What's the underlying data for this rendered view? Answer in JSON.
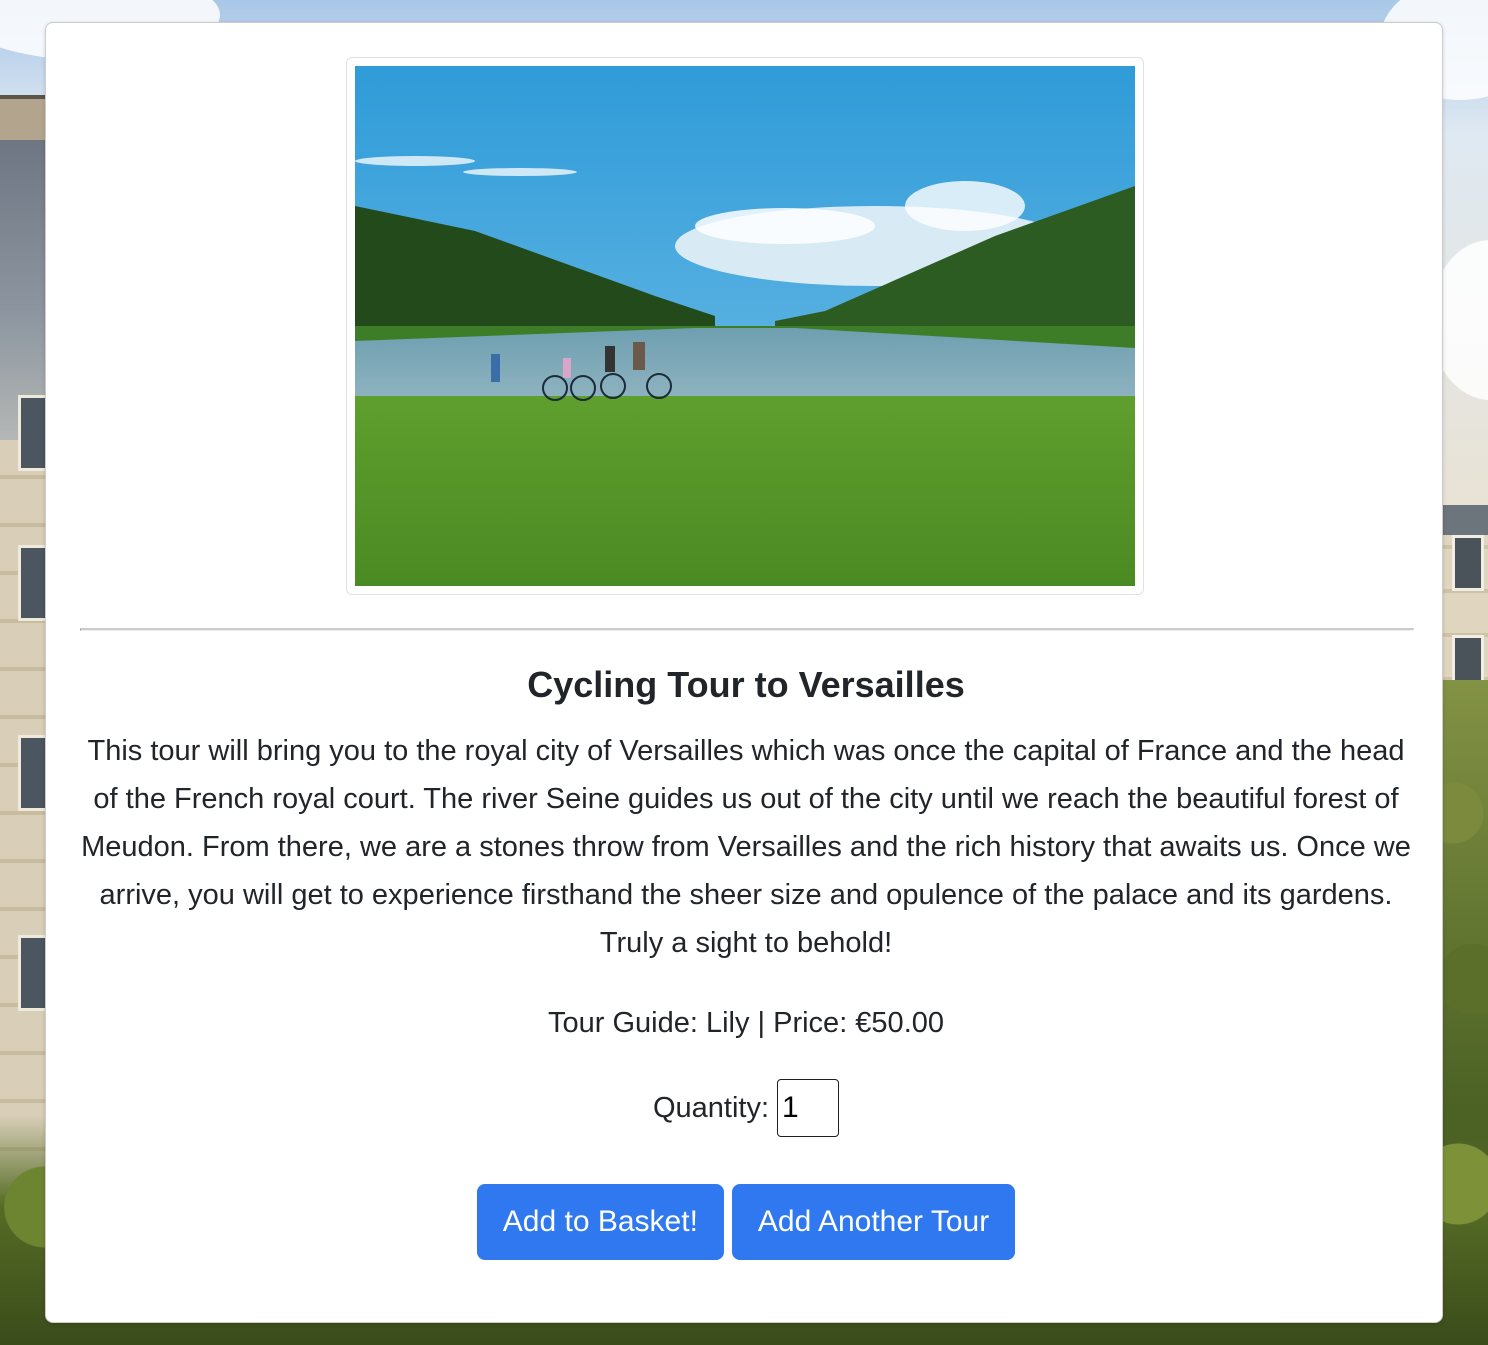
{
  "tour": {
    "title": "Cycling Tour to Versailles",
    "description": "This tour will bring you to the royal city of Versailles which was once the capital of France and the head of the French royal court. The river Seine guides us out of the city until we reach the beautiful forest of Meudon. From there, we are a stones throw from Versailles and the rich history that awaits us. Once we arrive, you will get to experience firsthand the sheer size and opulence of the palace and its gardens. Truly a sight to behold!",
    "meta_line": "Tour Guide: Lily | Price: €50.00"
  },
  "form": {
    "quantity_label": "Quantity:",
    "quantity_value": "1",
    "add_to_basket_label": "Add to Basket!",
    "add_another_label": "Add Another Tour"
  },
  "colors": {
    "primary_button": "#2f78f0",
    "card_background": "#ffffff",
    "text": "#212529"
  }
}
